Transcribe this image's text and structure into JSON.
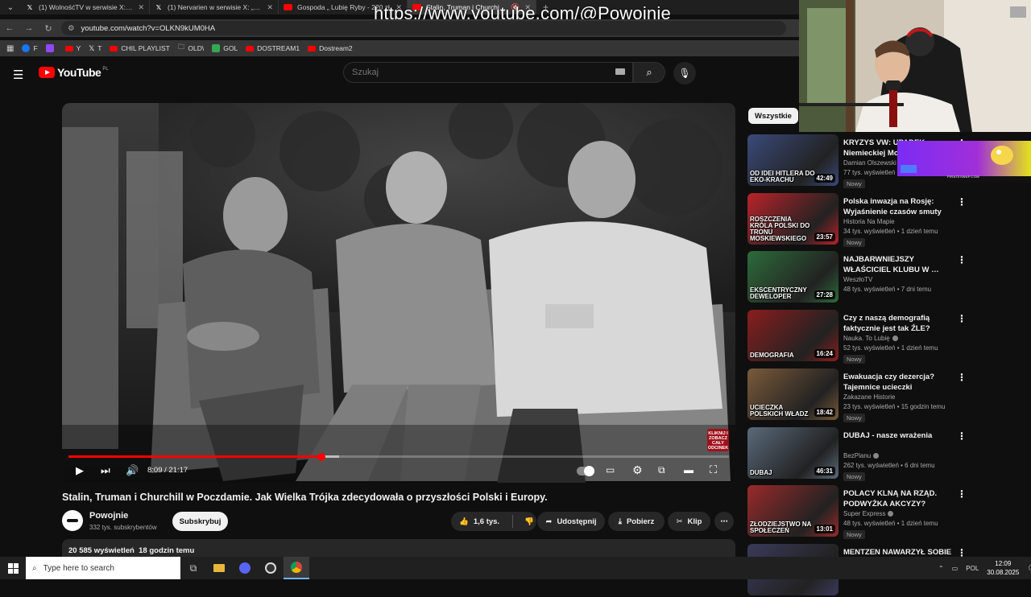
{
  "browser": {
    "tabs": [
      {
        "title": "(1) WolnośćTV w serwisie X: „It…",
        "icon": "x-icon"
      },
      {
        "title": "(1) Nervarien w serwisie X: „Co…",
        "icon": "x-icon"
      },
      {
        "title": "Gospoda „ Lubię Ryby - 220 zł",
        "icon": "youtube-icon"
      },
      {
        "title": "Stalin, Truman i Churchill w…",
        "icon": "youtube-icon",
        "active": true
      }
    ],
    "url": "youtube.com/watch?v=OLKN9kUM0HA",
    "bookmarks": [
      {
        "label": "F",
        "color": "#1877f2"
      },
      {
        "label": "",
        "color": "#9146ff"
      },
      {
        "label": "Y",
        "color": "#ff0000"
      },
      {
        "label": "T",
        "color": "#ffffff"
      },
      {
        "label": "CHIL PLAYLIST",
        "color": "#ff0000"
      },
      {
        "label": "OLD\\",
        "color": "#cccccc"
      },
      {
        "label": "GOL",
        "color": "#34a853"
      },
      {
        "label": "DOSTREAM1",
        "color": "#ff0000"
      },
      {
        "label": "Dostream2",
        "color": "#ff0000"
      }
    ]
  },
  "overlay_url": "https://www.youtube.com/@Powojnie",
  "youtube": {
    "logo_text": "YouTube",
    "logo_country": "PL",
    "search_placeholder": "Szukaj"
  },
  "player": {
    "current_time": "8:09",
    "total_time": "21:17",
    "time_display": "8:09 / 21:17",
    "progress_fraction": 0.383,
    "buffer_fraction": 0.41,
    "watermark": "KLIKNIJ I ZOBACZ CAŁY ODCINEK"
  },
  "video": {
    "title": "Stalin, Truman i Churchill w Poczdamie. Jak Wielka Trójka zdecydowała o przyszłości Polski i Europy.",
    "channel": "Powojnie",
    "subscribers": "332 tys. subskrybentów",
    "subscribe_label": "Subskrybuj",
    "likes": "1,6 tys.",
    "share_label": "Udostępnij",
    "download_label": "Pobierz",
    "clip_label": "Klip",
    "description_meta": "20 585 wyświetleń  18 godzin temu"
  },
  "sidebar": {
    "chip": "Wszystkie",
    "items": [
      {
        "title": "KRYZYS VW: UPADEK Niemieckiej Mot…",
        "channel": "Damian Olszewski",
        "verified": false,
        "views": "77 tys. wyświetleń",
        "badge": "Nowy",
        "duration": "42:49",
        "thumb_text": "OD IDEI HITLERA DO EKO-KRACHU",
        "color": "#3a4a7a"
      },
      {
        "title": "Polska inwazja na Rosję: Wyjaśnienie czasów smuty",
        "channel": "Historia Na Mapie",
        "verified": false,
        "views": "34 tys. wyświetleń • 1 dzień temu",
        "badge": "Nowy",
        "duration": "23:57",
        "thumb_text": "ROSZCZENIA KRÓLA POLSKI DO TRONU MOSKIEWSKIEGO",
        "color": "#b8232a"
      },
      {
        "title": "NAJBARWNIEJSZY WŁAŚCICIEL KLUBU W …",
        "channel": "WeszłoTV",
        "verified": false,
        "views": "48 tys. wyświetleń • 7 dni temu",
        "badge": "",
        "duration": "27:28",
        "thumb_text": "EKSCENTRYCZNY DEWELOPER",
        "color": "#2d6b3a"
      },
      {
        "title": "Czy z naszą demografią faktycznie jest tak ŹLE?",
        "channel": "Nauka. To Lubię",
        "verified": true,
        "views": "52 tys. wyświetleń • 1 dzień temu",
        "badge": "Nowy",
        "duration": "16:24",
        "thumb_text": "DEMOGRAFIA",
        "color": "#8a1d1d"
      },
      {
        "title": "Ewakuacja czy dezercja? Tajemnice ucieczki sanacyjny…",
        "channel": "Zakazane Historie",
        "verified": false,
        "views": "23 tys. wyświetleń • 15 godzin temu",
        "badge": "Nowy",
        "duration": "18:42",
        "thumb_text": "UCIECZKA POLSKICH WŁADZ",
        "color": "#7a5a3a"
      },
      {
        "title": "DUBAJ - nasze wrażenia",
        "channel": "BezPlanu",
        "verified": true,
        "views": "262 tys. wyświetleń • 6 dni temu",
        "badge": "Nowy",
        "duration": "46:31",
        "thumb_text": "DUBAJ",
        "color": "#5a6a7a"
      },
      {
        "title": "POLACY KLNĄ NA RZĄD. PODWYŻKA AKCYZY? WÓDKA…",
        "channel": "Super Express",
        "verified": true,
        "views": "48 tys. wyświetleń • 1 dzień temu",
        "badge": "Nowy",
        "duration": "13:01",
        "thumb_text": "ZŁODZIEJSTWO NA SPOŁECZEŃ",
        "color": "#9a2a2a"
      },
      {
        "title": "MENTZEN NAWARZYŁ SOBIE PIWA: WZMOCNIŁ POZYCJĘ …",
        "channel": "",
        "verified": false,
        "views": "",
        "badge": "",
        "duration": "",
        "thumb_text": "",
        "color": "#3a3a5a"
      }
    ]
  },
  "webcam_banner": "PIRATESWAP.COM",
  "taskbar": {
    "search_placeholder": "Type here to search",
    "language": "POL",
    "time": "12:09",
    "date": "30.08.2025",
    "notifications": "4"
  }
}
